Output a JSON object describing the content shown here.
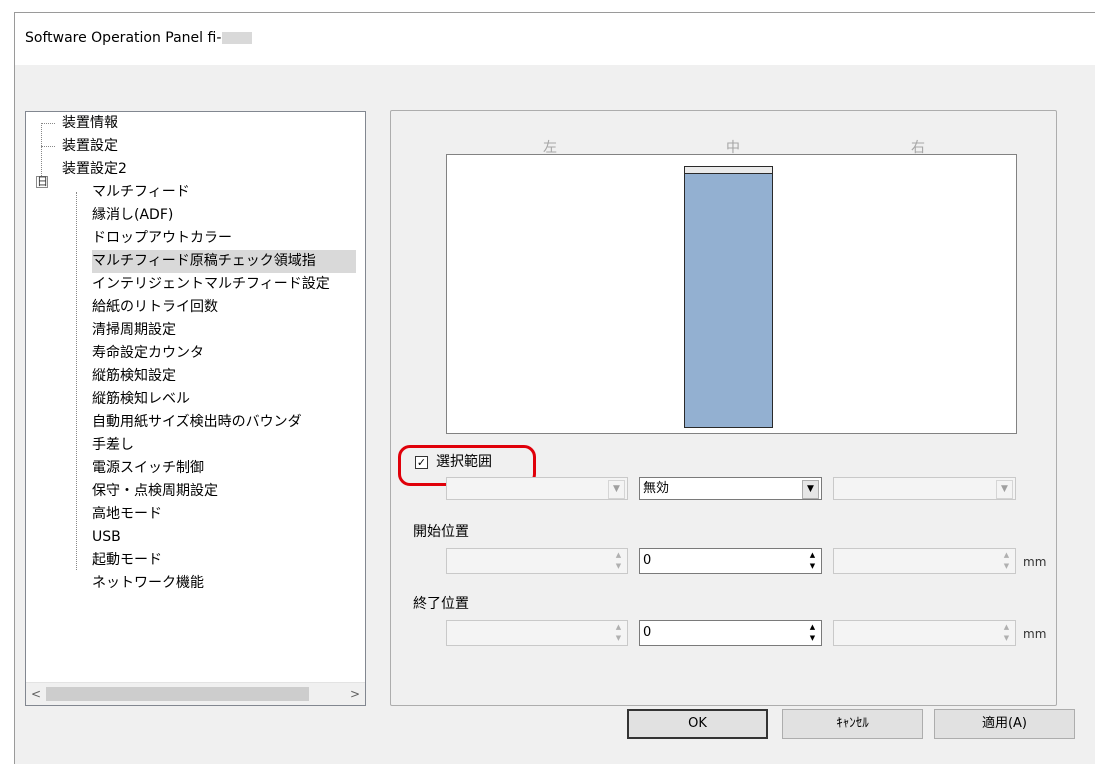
{
  "window": {
    "title": "Software Operation Panel fi-"
  },
  "tree": {
    "items": [
      "装置情報",
      "装置設定",
      "装置設定2",
      "マルチフィード",
      "縁消し(ADF)",
      "ドロップアウトカラー",
      "マルチフィード原稿チェック領域指",
      "インテリジェントマルチフィード設定",
      "給紙のリトライ回数",
      "清掃周期設定",
      "寿命設定カウンタ",
      "縦筋検知設定",
      "縦筋検知レベル",
      "自動用紙サイズ検出時のバウンダ",
      "手差し",
      "電源スイッチ制御",
      "保守・点検周期設定",
      "高地モード",
      "USB",
      "起動モード",
      "ネットワーク機能"
    ],
    "expander": "日",
    "scroll_left": "<",
    "scroll_right": ">"
  },
  "panel": {
    "columns": [
      "左",
      "中",
      "右"
    ],
    "checkbox": {
      "label": "選択範囲",
      "mark": "✓",
      "checked": true
    },
    "combos": {
      "left": "",
      "center": "無効",
      "right": ""
    },
    "start_label": "開始位置",
    "end_label": "終了位置",
    "start_values": {
      "left": "",
      "center": "0",
      "right": ""
    },
    "end_values": {
      "left": "",
      "center": "0",
      "right": ""
    },
    "unit": "mm"
  },
  "buttons": {
    "ok": "OK",
    "cancel": "ｷｬﾝｾﾙ",
    "apply": "適用(A)"
  },
  "colors": {
    "bar_fill": "#93b0d1",
    "highlight": "#e0000a"
  }
}
